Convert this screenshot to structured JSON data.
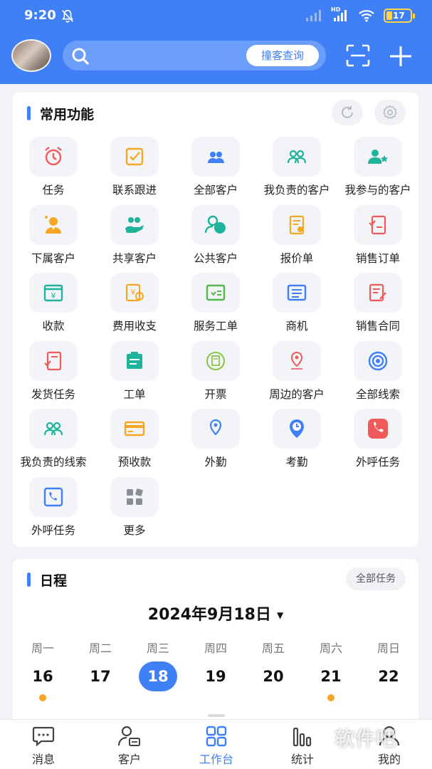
{
  "status_bar": {
    "time": "9:20",
    "battery": "17",
    "network": "HD"
  },
  "header": {
    "search_button_label": "撞客查询",
    "search_placeholder": ""
  },
  "common_functions": {
    "title": "常用功能",
    "items": [
      {
        "label": "任务",
        "icon": "alarm-clock-icon",
        "color": "#f05a5a"
      },
      {
        "label": "联系跟进",
        "icon": "checklist-icon",
        "color": "#f5a623"
      },
      {
        "label": "全部客户",
        "icon": "people-icon",
        "color": "#3f80f7"
      },
      {
        "label": "我负责的客户",
        "icon": "group-icon",
        "color": "#1fb39c"
      },
      {
        "label": "我参与的客户",
        "icon": "person-star-icon",
        "color": "#1fb39c"
      },
      {
        "label": "下属客户",
        "icon": "subordinate-icon",
        "color": "#f5a623"
      },
      {
        "label": "共享客户",
        "icon": "share-hand-icon",
        "color": "#1fb39c"
      },
      {
        "label": "公共客户",
        "icon": "public-people-icon",
        "color": "#1fb39c"
      },
      {
        "label": "报价单",
        "icon": "quote-doc-icon",
        "color": "#f5a623"
      },
      {
        "label": "销售订单",
        "icon": "order-doc-icon",
        "color": "#f05a5a"
      },
      {
        "label": "收款",
        "icon": "calendar-yen-icon",
        "color": "#1fb39c"
      },
      {
        "label": "费用收支",
        "icon": "expense-icon",
        "color": "#f5a623"
      },
      {
        "label": "服务工单",
        "icon": "service-order-icon",
        "color": "#52b84a"
      },
      {
        "label": "商机",
        "icon": "opportunity-icon",
        "color": "#3f80f7"
      },
      {
        "label": "销售合同",
        "icon": "contract-icon",
        "color": "#f05a5a"
      },
      {
        "label": "发货任务",
        "icon": "shipping-doc-icon",
        "color": "#f05a5a"
      },
      {
        "label": "工单",
        "icon": "work-order-icon",
        "color": "#1fb39c"
      },
      {
        "label": "开票",
        "icon": "invoice-icon",
        "color": "#8bc34a"
      },
      {
        "label": "周边的客户",
        "icon": "location-pin-icon",
        "color": "#f05a5a"
      },
      {
        "label": "全部线索",
        "icon": "target-icon",
        "color": "#3f80f7"
      },
      {
        "label": "我负责的线索",
        "icon": "lead-group-icon",
        "color": "#1fb39c"
      },
      {
        "label": "预收款",
        "icon": "card-icon",
        "color": "#f5a623"
      },
      {
        "label": "外勤",
        "icon": "field-pin-icon",
        "color": "#3f80f7"
      },
      {
        "label": "考勤",
        "icon": "attendance-icon",
        "color": "#3f80f7"
      },
      {
        "label": "外呼任务",
        "icon": "phone-icon",
        "color": "#f05a5a"
      },
      {
        "label": "外呼任务",
        "icon": "call-list-icon",
        "color": "#3f80f7"
      },
      {
        "label": "更多",
        "icon": "more-grid-icon",
        "color": "#8a8d96"
      }
    ]
  },
  "schedule": {
    "title": "日程",
    "all_tasks_label": "全部任务",
    "date_title": "2024年9月18日",
    "weekdays": [
      "周一",
      "周二",
      "周三",
      "周四",
      "周五",
      "周六",
      "周日"
    ],
    "days": [
      "16",
      "17",
      "18",
      "19",
      "20",
      "21",
      "22"
    ],
    "selected_day": "18",
    "days_with_events": [
      "16",
      "21"
    ]
  },
  "tabs": [
    {
      "label": "消息",
      "icon": "message-icon"
    },
    {
      "label": "客户",
      "icon": "customer-icon"
    },
    {
      "label": "工作台",
      "icon": "workbench-icon",
      "active": true
    },
    {
      "label": "统计",
      "icon": "stats-icon"
    },
    {
      "label": "我的",
      "icon": "profile-icon"
    }
  ],
  "watermark": "软件吧"
}
